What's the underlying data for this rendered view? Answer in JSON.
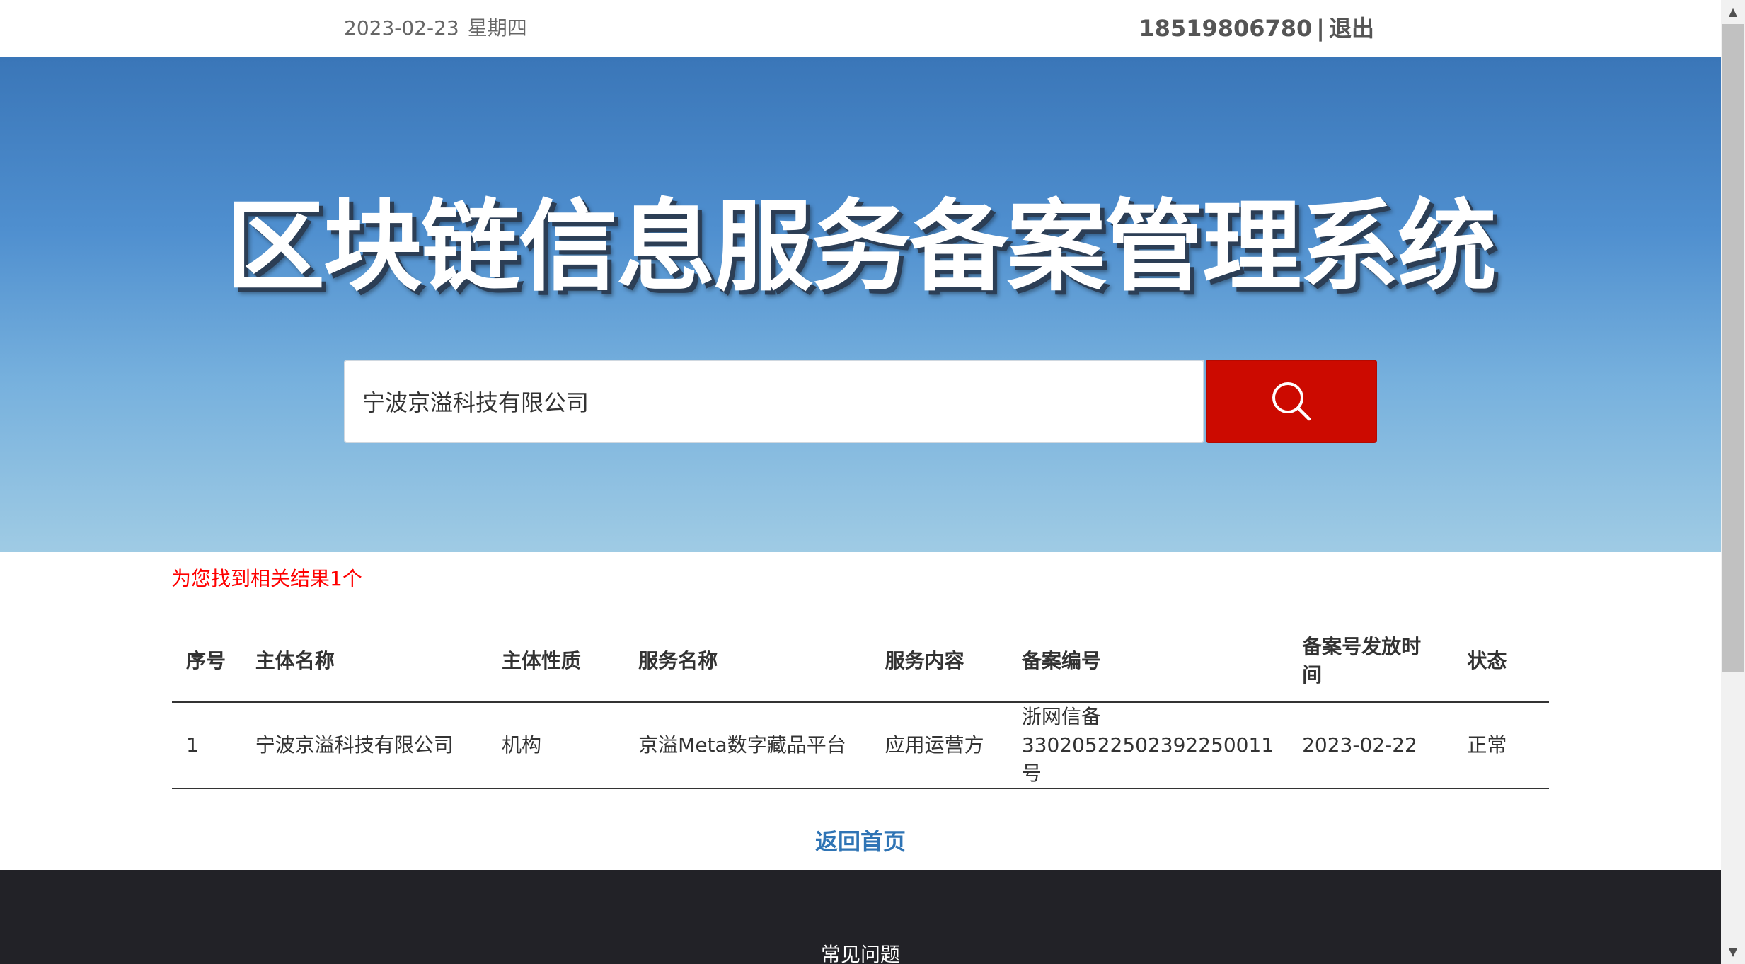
{
  "header": {
    "date": "2023-02-23",
    "weekday": "星期四",
    "phone": "18519806780",
    "separator": "|",
    "logout": "退出"
  },
  "banner": {
    "title": "区块链信息服务备案管理系统"
  },
  "search": {
    "value": "宁波京溢科技有限公司",
    "icon": "search-icon"
  },
  "results": {
    "summary": "为您找到相关结果1个",
    "columns": [
      "序号",
      "主体名称",
      "主体性质",
      "服务名称",
      "服务内容",
      "备案编号",
      "备案号发放时间",
      "状态"
    ],
    "rows": [
      {
        "index": "1",
        "entity_name": "宁波京溢科技有限公司",
        "entity_type": "机构",
        "service_name": "京溢Meta数字藏品平台",
        "service_content": "应用运营方",
        "record_no_prefix": "浙网信备",
        "record_no": "33020522502392250011号",
        "issue_date": "2023-02-22",
        "status": "正常"
      }
    ]
  },
  "back_home": "返回首页",
  "footer": {
    "faq": "常见问题"
  },
  "colors": {
    "search_button": "#cc0a00",
    "result_summary": "#ff0000",
    "link": "#2f74b5",
    "footer_bg": "#222227"
  }
}
